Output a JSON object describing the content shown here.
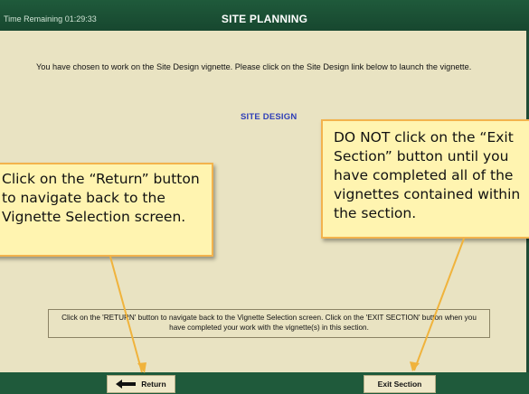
{
  "header": {
    "time_remaining": "Time Remaining 01:29:33",
    "title": "SITE PLANNING"
  },
  "main": {
    "intro_text": "You have chosen to work on the Site Design vignette. Please click on the Site Design link below to launch the vignette.",
    "site_design_link": "SITE DESIGN",
    "instructions": "Click on the 'RETURN' button to navigate back to the Vignette Selection screen. Click on the 'EXIT SECTION' button when you have completed your work with the vignette(s) in this section."
  },
  "callouts": {
    "left_text": "Click on the “Return” button to navigate back to the Vignette Selection screen.",
    "right_text": "DO NOT click on the “Exit Section” button until you have completed all of the vignettes contained within the section."
  },
  "footer": {
    "return_label": "Return",
    "exit_label": "Exit Section"
  },
  "colors": {
    "bar_green": "#1f5a3b",
    "background": "#e9e3c2",
    "link_blue": "#2f3fb8",
    "callout_fill": "#fff4b0",
    "callout_border": "#f3b34d",
    "arrow": "#f0b33c"
  },
  "icons": {
    "return_icon": "left-arrow-icon"
  }
}
